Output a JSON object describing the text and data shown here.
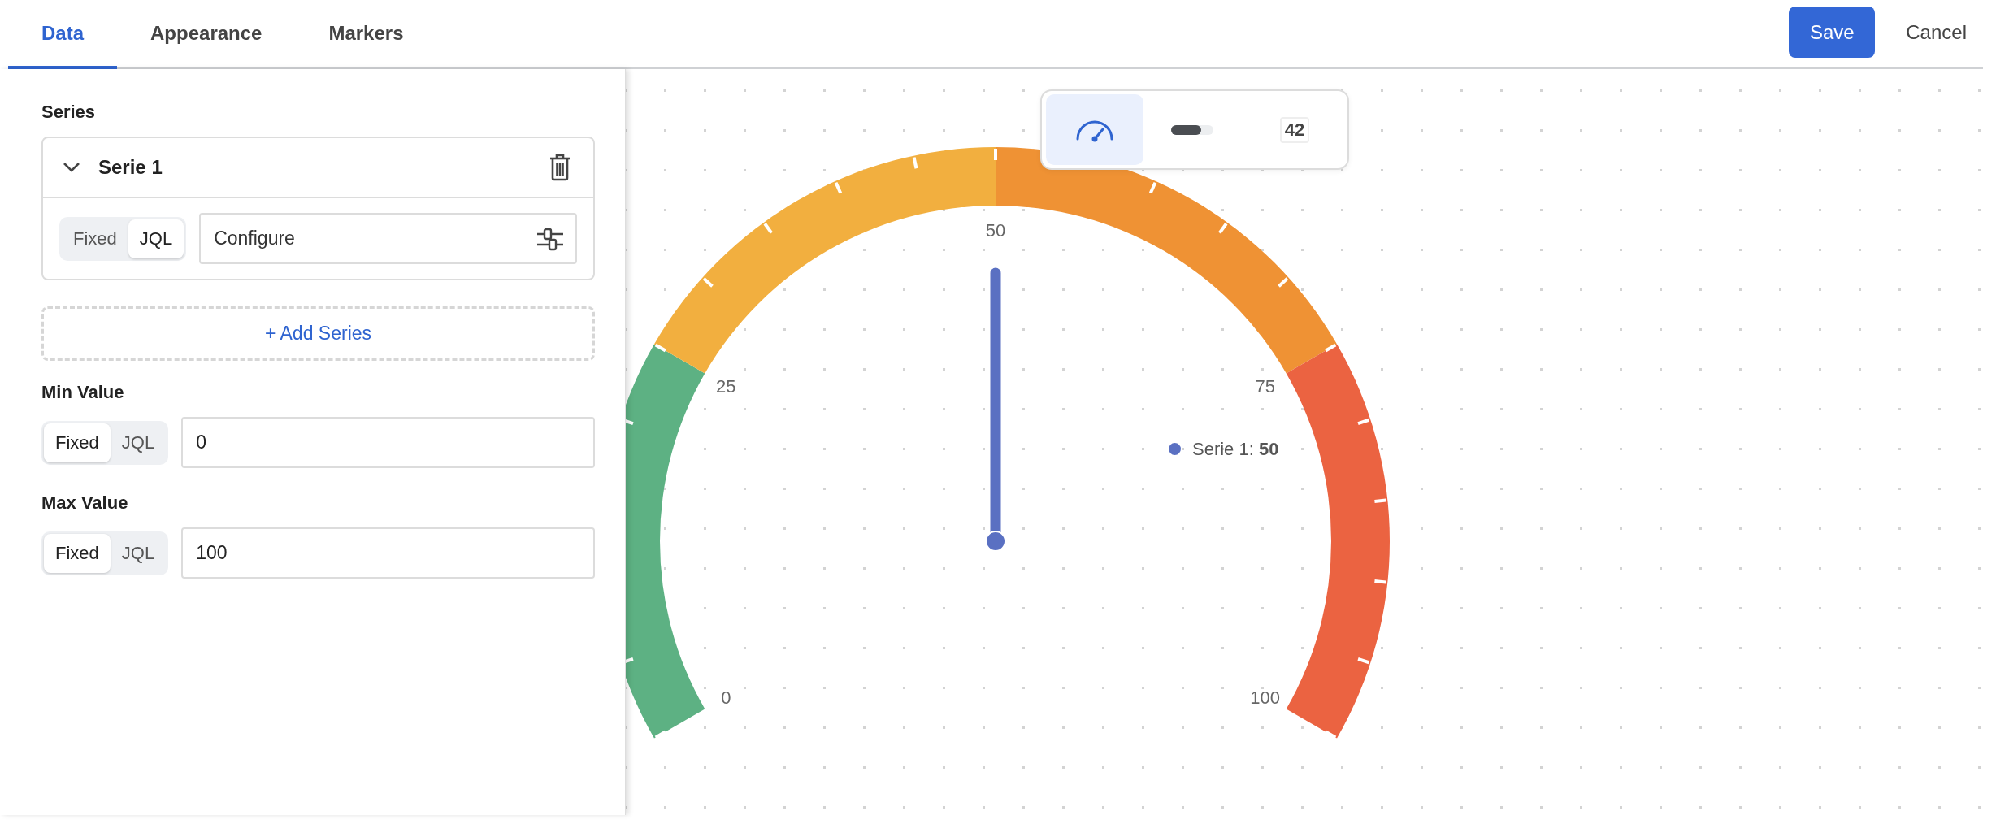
{
  "tabs": [
    {
      "label": "Data",
      "selected": true
    },
    {
      "label": "Appearance",
      "selected": false
    },
    {
      "label": "Markers",
      "selected": false
    }
  ],
  "actions": {
    "save": "Save",
    "cancel": "Cancel"
  },
  "panel": {
    "series_label": "Series",
    "series": [
      {
        "name": "Serie 1",
        "expanded": true,
        "modes": [
          {
            "label": "Fixed",
            "selected": false
          },
          {
            "label": "JQL",
            "selected": true
          }
        ],
        "query_button": "Configure"
      }
    ],
    "add_series": "+ Add Series",
    "min": {
      "label": "Min Value",
      "modes": [
        {
          "label": "Fixed",
          "selected": true
        },
        {
          "label": "JQL",
          "selected": false
        }
      ],
      "value": "0"
    },
    "max": {
      "label": "Max Value",
      "modes": [
        {
          "label": "Fixed",
          "selected": true
        },
        {
          "label": "JQL",
          "selected": false
        }
      ],
      "value": "100"
    }
  },
  "view_switcher": [
    {
      "kind": "gauge",
      "selected": true
    },
    {
      "kind": "bar",
      "selected": false
    },
    {
      "kind": "number",
      "label": "42",
      "selected": false
    }
  ],
  "gauge": {
    "level": 0.5,
    "tick_labels": [
      "0",
      "25",
      "50",
      "75",
      "100"
    ],
    "bands": [
      {
        "color": "#5db183"
      },
      {
        "color": "#f2af3f"
      },
      {
        "color": "#ef9234"
      },
      {
        "color": "#eb6341"
      }
    ]
  },
  "legend": [
    {
      "text": "Serie 1: **50**",
      "color": "#5a70c2"
    }
  ]
}
